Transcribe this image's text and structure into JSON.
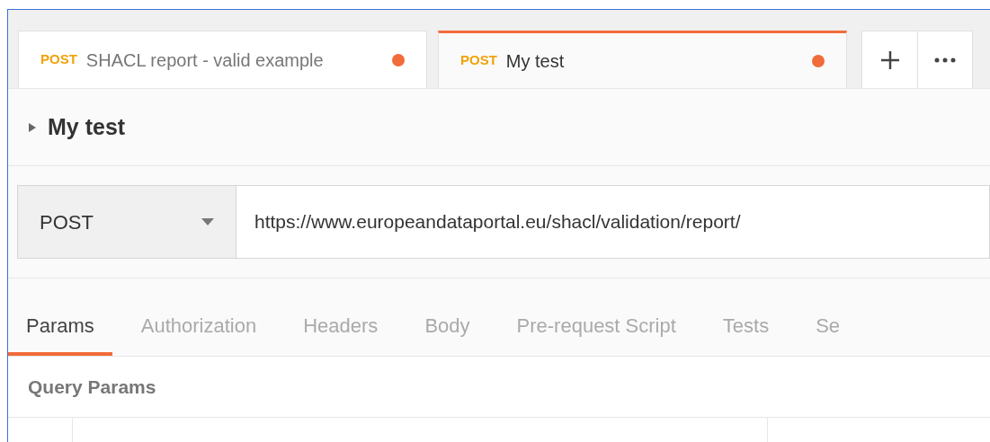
{
  "request_tabs": [
    {
      "method": "POST",
      "title": "SHACL report - valid example",
      "unsaved": true,
      "selected": false
    },
    {
      "method": "POST",
      "title": "My test",
      "unsaved": true,
      "selected": true
    }
  ],
  "request": {
    "name": "My test",
    "expanded": false,
    "method": "POST",
    "url": "https://www.europeandataportal.eu/shacl/validation/report/"
  },
  "section_tabs": [
    {
      "label": "Params",
      "selected": true
    },
    {
      "label": "Authorization",
      "selected": false
    },
    {
      "label": "Headers",
      "selected": false
    },
    {
      "label": "Body",
      "selected": false
    },
    {
      "label": "Pre-request Script",
      "selected": false
    },
    {
      "label": "Tests",
      "selected": false
    },
    {
      "label": "Se",
      "selected": false
    }
  ],
  "query_params": {
    "title": "Query Params"
  }
}
